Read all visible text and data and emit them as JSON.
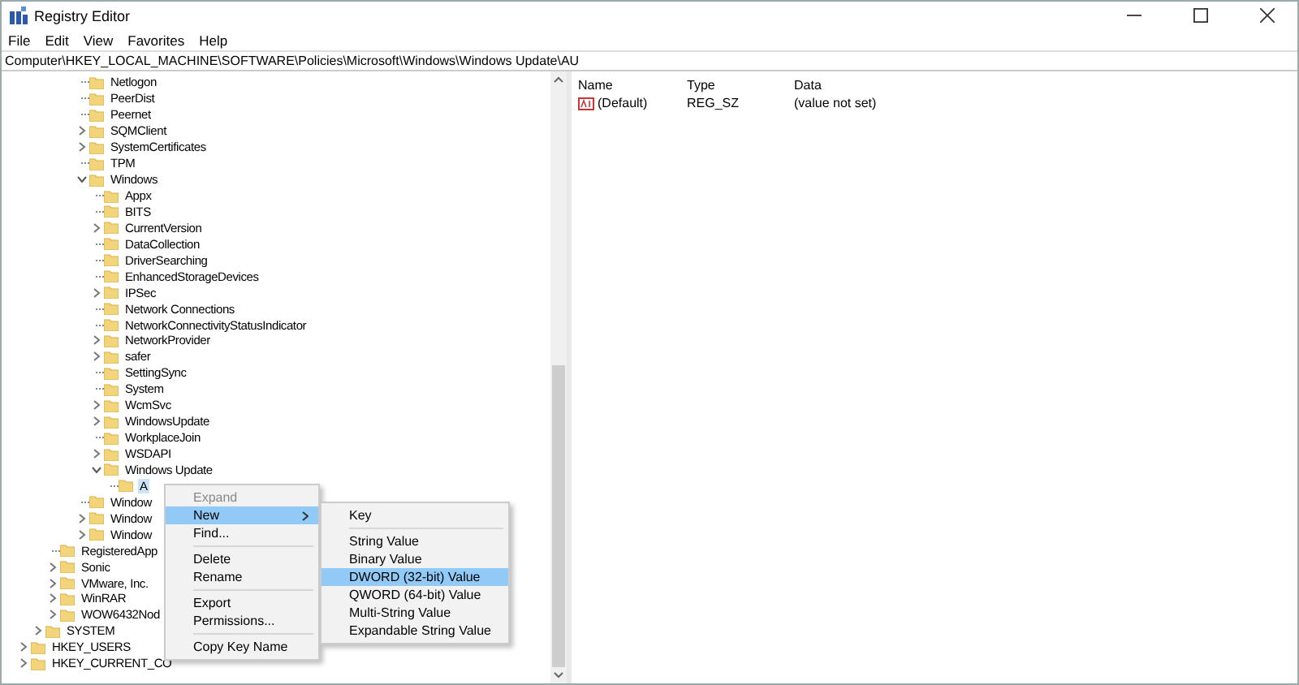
{
  "window": {
    "title": "Registry Editor"
  },
  "menu_bar": [
    "File",
    "Edit",
    "View",
    "Favorites",
    "Help"
  ],
  "address_bar": {
    "path": "Computer\\HKEY_LOCAL_MACHINE\\SOFTWARE\\Policies\\Microsoft\\Windows\\Windows Update\\AU"
  },
  "tree": [
    {
      "children": [
        {
          "children": [
            {
              "children": [
                {
                  "children": [
                    {
                      "label": "Netlogon",
                      "kind": "leaf",
                      "selected": false
                    },
                    {
                      "label": "PeerDist",
                      "kind": "leaf",
                      "selected": false
                    },
                    {
                      "label": "Peernet",
                      "kind": "leaf",
                      "selected": false
                    },
                    {
                      "label": "SQMClient",
                      "kind": "collapsed",
                      "selected": false
                    },
                    {
                      "label": "SystemCertificates",
                      "kind": "collapsed",
                      "selected": false
                    },
                    {
                      "label": "TPM",
                      "kind": "leaf",
                      "selected": false
                    },
                    {
                      "label": "Windows",
                      "kind": "expanded",
                      "selected": false,
                      "children": [
                        {
                          "label": "Appx",
                          "kind": "leaf",
                          "selected": false
                        },
                        {
                          "label": "BITS",
                          "kind": "leaf",
                          "selected": false
                        },
                        {
                          "label": "CurrentVersion",
                          "kind": "collapsed",
                          "selected": false
                        },
                        {
                          "label": "DataCollection",
                          "kind": "leaf",
                          "selected": false
                        },
                        {
                          "label": "DriverSearching",
                          "kind": "leaf",
                          "selected": false
                        },
                        {
                          "label": "EnhancedStorageDevices",
                          "kind": "leaf",
                          "selected": false
                        },
                        {
                          "label": "IPSec",
                          "kind": "collapsed",
                          "selected": false
                        },
                        {
                          "label": "Network Connections",
                          "kind": "leaf",
                          "selected": false
                        },
                        {
                          "label": "NetworkConnectivityStatusIndicator",
                          "kind": "leaf",
                          "selected": false
                        },
                        {
                          "label": "NetworkProvider",
                          "kind": "collapsed",
                          "selected": false
                        },
                        {
                          "label": "safer",
                          "kind": "collapsed",
                          "selected": false
                        },
                        {
                          "label": "SettingSync",
                          "kind": "leaf",
                          "selected": false
                        },
                        {
                          "label": "System",
                          "kind": "leaf",
                          "selected": false
                        },
                        {
                          "label": "WcmSvc",
                          "kind": "collapsed",
                          "selected": false
                        },
                        {
                          "label": "WindowsUpdate",
                          "kind": "collapsed",
                          "selected": false
                        },
                        {
                          "label": "WorkplaceJoin",
                          "kind": "leaf",
                          "selected": false
                        },
                        {
                          "label": "WSDAPI",
                          "kind": "collapsed",
                          "selected": false
                        },
                        {
                          "label": "Windows Update",
                          "kind": "expanded",
                          "selected": false,
                          "children": [
                            {
                              "label": "A",
                              "kind": "leaf",
                              "selected": true
                            }
                          ]
                        }
                      ]
                    },
                    {
                      "label": "Window",
                      "kind": "leaf",
                      "selected": false
                    },
                    {
                      "label": "Window",
                      "kind": "collapsed",
                      "selected": false
                    },
                    {
                      "label": "Window",
                      "kind": "collapsed",
                      "selected": false
                    }
                  ]
                }
              ]
            },
            {
              "label": "RegisteredApp",
              "kind": "leaf",
              "selected": false
            },
            {
              "label": "Sonic",
              "kind": "collapsed",
              "selected": false
            },
            {
              "label": "VMware, Inc.",
              "kind": "collapsed",
              "selected": false
            },
            {
              "label": "WinRAR",
              "kind": "collapsed",
              "selected": false
            },
            {
              "label": "WOW6432Nod",
              "kind": "collapsed",
              "selected": false
            }
          ]
        },
        {
          "label": "SYSTEM",
          "kind": "collapsed",
          "selected": false
        }
      ]
    },
    {
      "label": "HKEY_USERS",
      "kind": "collapsed",
      "selected": false
    },
    {
      "label": "HKEY_CURRENT_CO",
      "kind": "collapsed",
      "selected": false
    }
  ],
  "values": {
    "columns": [
      "Name",
      "Type",
      "Data"
    ],
    "rows": [
      {
        "name": "(Default)",
        "type": "REG_SZ",
        "data": "(value not set)"
      }
    ]
  },
  "context_menu": {
    "items": [
      {
        "kind": "item",
        "label": "Expand",
        "disabled": true,
        "selected": false
      },
      {
        "kind": "submenu",
        "label": "New",
        "disabled": false,
        "selected": true
      },
      {
        "kind": "item",
        "label": "Find...",
        "disabled": false,
        "selected": false
      },
      {
        "kind": "separator"
      },
      {
        "kind": "item",
        "label": "Delete",
        "disabled": false,
        "selected": false
      },
      {
        "kind": "item",
        "label": "Rename",
        "disabled": false,
        "selected": false
      },
      {
        "kind": "separator"
      },
      {
        "kind": "item",
        "label": "Export",
        "disabled": false,
        "selected": false
      },
      {
        "kind": "item",
        "label": "Permissions...",
        "disabled": false,
        "selected": false
      },
      {
        "kind": "separator"
      },
      {
        "kind": "item",
        "label": "Copy Key Name",
        "disabled": false,
        "selected": false
      }
    ],
    "submenu": [
      {
        "kind": "item",
        "label": "Key",
        "selected": false
      },
      {
        "kind": "separator"
      },
      {
        "kind": "item",
        "label": "String Value",
        "selected": false
      },
      {
        "kind": "item",
        "label": "Binary Value",
        "selected": false
      },
      {
        "kind": "item",
        "label": "DWORD (32-bit) Value",
        "selected": true
      },
      {
        "kind": "item",
        "label": "QWORD (64-bit) Value",
        "selected": false
      },
      {
        "kind": "item",
        "label": "Multi-String Value",
        "selected": false
      },
      {
        "kind": "item",
        "label": "Expandable String Value",
        "selected": false
      }
    ]
  }
}
